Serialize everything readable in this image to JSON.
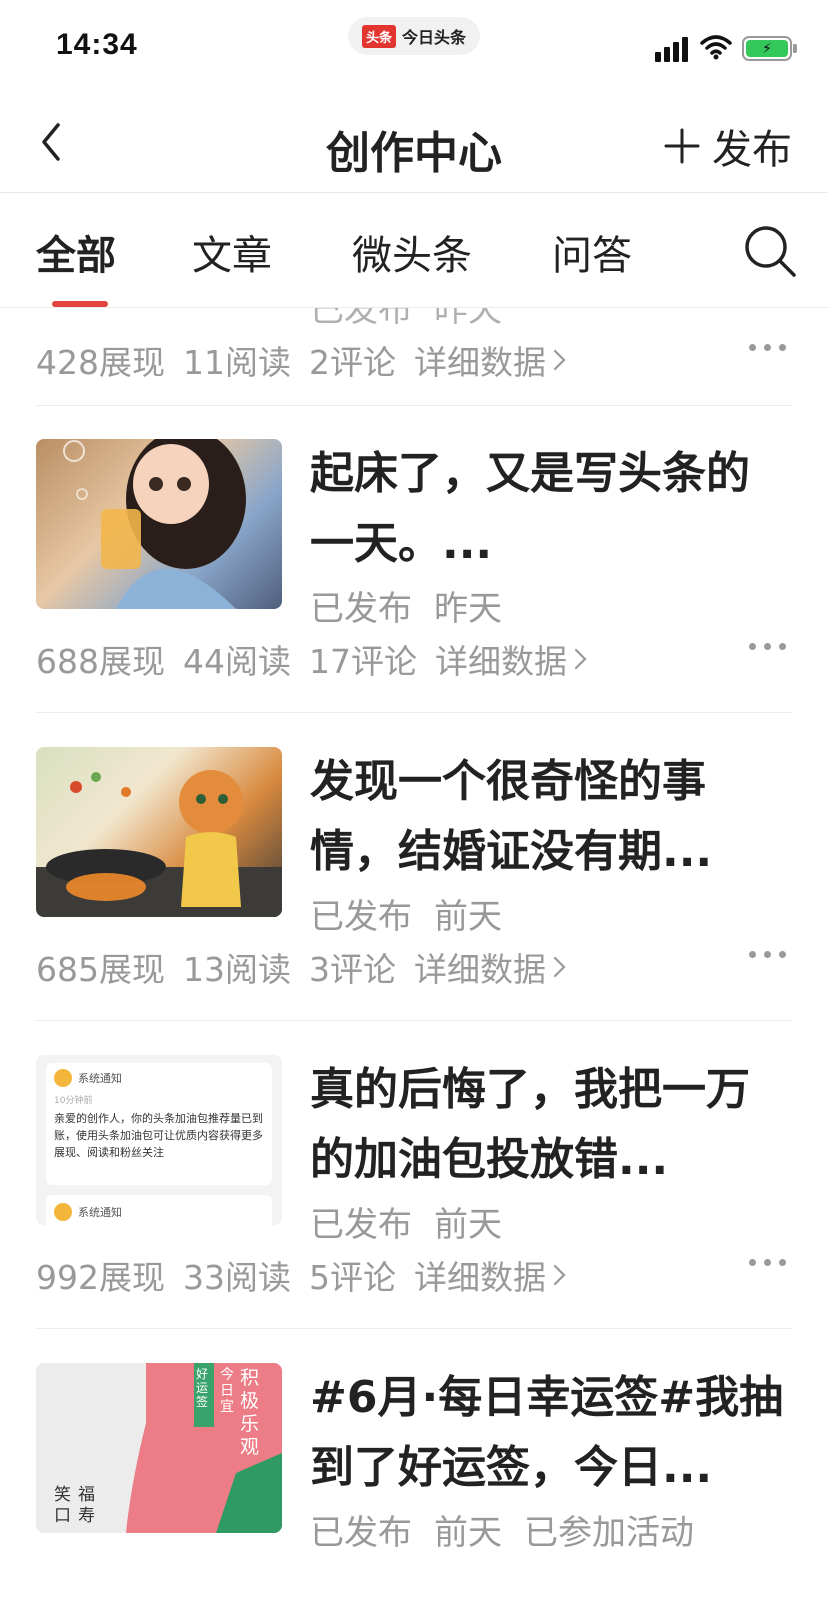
{
  "status_bar": {
    "time": "14:34",
    "app_logo": "头条",
    "app_name": "今日头条",
    "icons": [
      "signal-icon",
      "wifi-icon",
      "battery-charging-icon"
    ]
  },
  "nav": {
    "back_icon": "chevron-left-icon",
    "title": "创作中心",
    "publish_label": "发布",
    "publish_icon": "plus-icon"
  },
  "tabs": {
    "items": [
      {
        "label": "全部",
        "active": true
      },
      {
        "label": "文章",
        "active": false
      },
      {
        "label": "微头条",
        "active": false
      },
      {
        "label": "问答",
        "active": false
      }
    ],
    "search_icon": "search-icon",
    "accent_color": "#e2453c"
  },
  "partial_item": {
    "meta_published": "已发布",
    "meta_time": "昨天",
    "views": "428展现",
    "reads": "11阅读",
    "comments": "2评论",
    "detail": "详细数据"
  },
  "posts": [
    {
      "title": "起床了，又是写头条的一天。...",
      "published": "已发布",
      "time": "昨天",
      "views": "688展现",
      "reads": "44阅读",
      "comments": "17评论",
      "detail": "详细数据"
    },
    {
      "title": "发现一个很奇怪的事情，结婚证没有期...",
      "published": "已发布",
      "time": "前天",
      "views": "685展现",
      "reads": "13阅读",
      "comments": "3评论",
      "detail": "详细数据"
    },
    {
      "title": "真的后悔了，我把一万的加油包投放错...",
      "published": "已发布",
      "time": "前天",
      "views": "992展现",
      "reads": "33阅读",
      "comments": "5评论",
      "detail": "详细数据",
      "thumb_text": {
        "notice_title": "系统通知",
        "notice_time": "10分钟前",
        "notice_body": "亲爱的创作人，你的头条加油包推荐量已到账，使用头条加油包可让优质内容获得更多展现、阅读和粉丝关注",
        "notice_title_2": "系统通知"
      }
    },
    {
      "title": "#6月·每日幸运签#我抽到了好运签，今日...",
      "published": "已发布",
      "time": "前天",
      "activity": "已参加活动",
      "thumb_text": {
        "badge": "好运签",
        "today": "今日宜",
        "motto": "积极乐观",
        "side_a": "笑口",
        "side_b": "福寿"
      }
    }
  ]
}
